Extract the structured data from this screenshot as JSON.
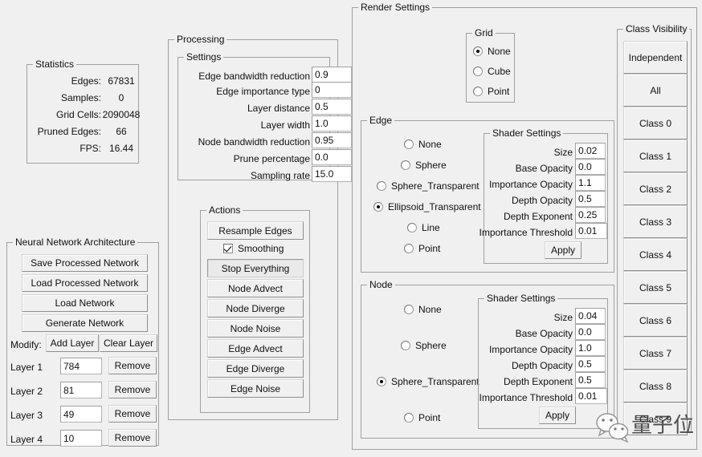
{
  "statistics": {
    "title": "Statistics",
    "rows": [
      {
        "label": "Edges:",
        "value": "67831"
      },
      {
        "label": "Samples:",
        "value": "0"
      },
      {
        "label": "Grid Cells:",
        "value": "2090048"
      },
      {
        "label": "Pruned Edges:",
        "value": "66"
      },
      {
        "label": "FPS:",
        "value": "16.44"
      }
    ]
  },
  "neural_network": {
    "title": "Neural Network Architecture",
    "buttons": [
      {
        "label": "Save Processed Network"
      },
      {
        "label": "Load Processed Network"
      },
      {
        "label": "Load Network"
      },
      {
        "label": "Generate Network"
      }
    ],
    "modify_label": "Modify:",
    "add_layer_label": "Add Layer",
    "clear_layer_label": "Clear Layer",
    "remove_label": "Remove",
    "layers": [
      {
        "label": "Layer 1",
        "value": "784"
      },
      {
        "label": "Layer 2",
        "value": "81"
      },
      {
        "label": "Layer 3",
        "value": "49"
      },
      {
        "label": "Layer 4",
        "value": "10"
      }
    ]
  },
  "processing": {
    "title": "Processing",
    "settings": {
      "title": "Settings",
      "fields": [
        {
          "label": "Edge bandwidth reduction",
          "value": "0.9"
        },
        {
          "label": "Edge importance type",
          "value": "0"
        },
        {
          "label": "Layer distance",
          "value": "0.5"
        },
        {
          "label": "Layer width",
          "value": "1.0"
        },
        {
          "label": "Node bandwidth reduction",
          "value": "0.95"
        },
        {
          "label": "Prune percentage",
          "value": "0.0"
        },
        {
          "label": "Sampling rate",
          "value": "15.0"
        }
      ]
    },
    "actions": {
      "title": "Actions",
      "resample_label": "Resample Edges",
      "smoothing_label": "Smoothing",
      "smoothing_checked": true,
      "buttons": [
        {
          "label": "Stop Everything",
          "pressed": true
        },
        {
          "label": "Node Advect",
          "pressed": false
        },
        {
          "label": "Node Diverge",
          "pressed": false
        },
        {
          "label": "Node Noise",
          "pressed": false
        },
        {
          "label": "Edge Advect",
          "pressed": false
        },
        {
          "label": "Edge Diverge",
          "pressed": false
        },
        {
          "label": "Edge Noise",
          "pressed": false
        }
      ]
    }
  },
  "render_settings": {
    "title": "Render Settings",
    "grid": {
      "title": "Grid",
      "options": [
        {
          "label": "None",
          "selected": true
        },
        {
          "label": "Cube",
          "selected": false
        },
        {
          "label": "Point",
          "selected": false
        }
      ]
    },
    "edge": {
      "title": "Edge",
      "options": [
        {
          "label": "None",
          "selected": false
        },
        {
          "label": "Sphere",
          "selected": false
        },
        {
          "label": "Sphere_Transparent",
          "selected": false
        },
        {
          "label": "Ellipsoid_Transparent",
          "selected": true
        },
        {
          "label": "Line",
          "selected": false
        },
        {
          "label": "Point",
          "selected": false
        }
      ],
      "shader": {
        "title": "Shader Settings",
        "fields": [
          {
            "label": "Size",
            "value": "0.02"
          },
          {
            "label": "Base Opacity",
            "value": "0.0"
          },
          {
            "label": "Importance Opacity",
            "value": "1.1"
          },
          {
            "label": "Depth Opacity",
            "value": "0.5"
          },
          {
            "label": "Depth Exponent",
            "value": "0.25"
          },
          {
            "label": "Importance Threshold",
            "value": "0.01"
          }
        ],
        "apply_label": "Apply"
      }
    },
    "node": {
      "title": "Node",
      "options": [
        {
          "label": "None",
          "selected": false
        },
        {
          "label": "Sphere",
          "selected": false
        },
        {
          "label": "Sphere_Transparent",
          "selected": true
        },
        {
          "label": "Point",
          "selected": false
        }
      ],
      "shader": {
        "title": "Shader Settings",
        "fields": [
          {
            "label": "Size",
            "value": "0.04"
          },
          {
            "label": "Base Opacity",
            "value": "0.0"
          },
          {
            "label": "Importance Opacity",
            "value": "1.0"
          },
          {
            "label": "Depth Opacity",
            "value": "0.5"
          },
          {
            "label": "Depth Exponent",
            "value": "0.5"
          },
          {
            "label": "Importance Threshold",
            "value": "0.01"
          }
        ],
        "apply_label": "Apply"
      }
    }
  },
  "class_visibility": {
    "title": "Class Visibility",
    "buttons": [
      {
        "label": "Independent"
      },
      {
        "label": "All"
      },
      {
        "label": "Class 0"
      },
      {
        "label": "Class 1"
      },
      {
        "label": "Class 2"
      },
      {
        "label": "Class 3"
      },
      {
        "label": "Class 4"
      },
      {
        "label": "Class 5"
      },
      {
        "label": "Class 6"
      },
      {
        "label": "Class 7"
      },
      {
        "label": "Class 8"
      },
      {
        "label": "Class 9"
      }
    ]
  },
  "watermark": {
    "text": "量子位"
  },
  "colors": {
    "background": "#f0f0f0",
    "group_border": "#a0a0a0",
    "button_face": "#f0f0f0",
    "input_background": "#ffffff",
    "text": "#101010"
  }
}
